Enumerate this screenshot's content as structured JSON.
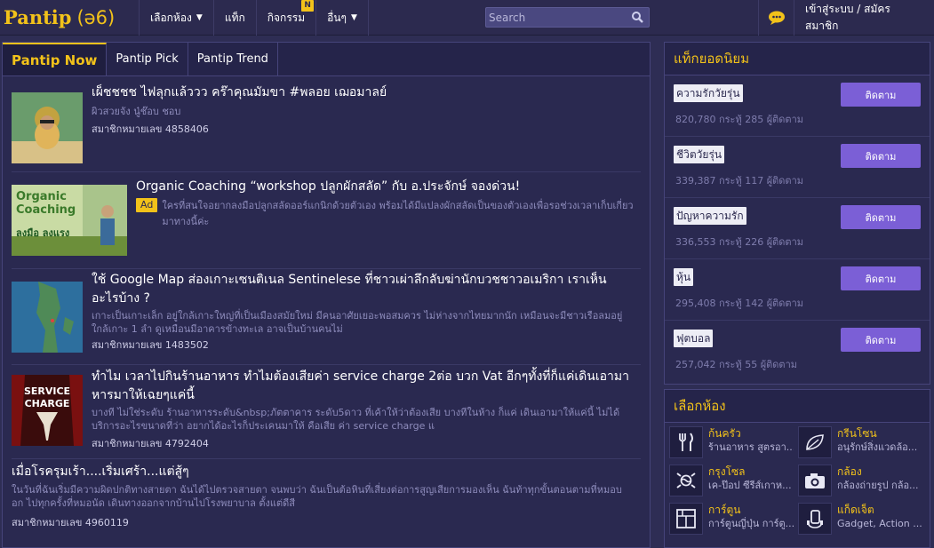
{
  "header": {
    "logo_text": "Pantip",
    "logo_thai": "(ə6)",
    "nav": [
      {
        "label": "เลือกห้อง",
        "has_caret": true
      },
      {
        "label": "แท็ก",
        "has_caret": false
      },
      {
        "label": "กิจกรรม",
        "has_caret": false,
        "badge": "N"
      },
      {
        "label": "อื่นๆ",
        "has_caret": true
      }
    ],
    "search_placeholder": "Search",
    "login_label": "เข้าสู่ระบบ / สมัครสมาชิก"
  },
  "tabs": [
    {
      "label": "Pantip Now",
      "active": true
    },
    {
      "label": "Pantip Pick",
      "active": false
    },
    {
      "label": "Pantip Trend",
      "active": false
    }
  ],
  "feed": [
    {
      "title": "เผ็ชชชช ไฟลุกแล้ววว คร๊าคุณมัมขา #พลอย เฌอมาลย์",
      "desc": "ผิวสวยจัง นู๋ช๊อบ ชอบ",
      "member": "สมาชิกหมายเลข 4858406"
    },
    {
      "title": "Organic Coaching “workshop ปลูกผักสลัด” กับ อ.ประจักษ์ จองด่วน!",
      "ad": "Ad",
      "desc": "ใครที่สนใจอยากลงมือปลูกสลัดออร์แกนิกด้วยตัวเอง พร้อมได้มีแปลงผักสลัดเป็นของตัวเองเพื่อรอช่วงเวลาเก็บเกี่ยวมาทางนี้ค่ะ",
      "thumb_text": [
        "Organic",
        "Coaching",
        "ลงมือ ลงแรง"
      ]
    },
    {
      "title": "ใช้ Google Map ส่องเกาะเซนติเนล Sentinelese ที่ชาวเผ่าลึกลับฆ่านักบวชชาวอเมริกา เราเห็นอะไรบ้าง ?",
      "desc": "เกาะเป็นเกาะเล็ก อยู่ใกล้เกาะใหญ่ที่เป็นเมืองสมัยใหม่ มีคนอาศัยเยอะพอสมควร ไม่ห่างจากไทยมากนัก เหมือนจะมีชาวเรือลมอยู่ใกล้เกาะ 1 ลำ ดูเหมือนมีอาคารข้างทะเล อาจเป็นบ้านคนไม่",
      "member": "สมาชิกหมายเลข 1483502"
    },
    {
      "title": "ทำไม เวลาไปกินร้านอาหาร ทำไมต้องเสียค่า service charge 2ต่อ บวก Vat อีกๆทั้งที่ก็แค่เดินเอามาหารมาให้เฉยๆแค่นี้",
      "desc": "บางที ไม่ใช่ระดับ ร้านอาหารระดับ&nbsp;ภัตตาคาร ระดับ5ดาว ที่เค้าให้ว่าต้องเสีย บางทีในห้าง ก็แค่ เดินเอามาให้แค่นี้ ไม่ได้บริการอะไรขนาดที่ว่า อยากได้อะไรก็ประเคนมาให้ คือเสีย ค่า service charge แ",
      "member": "สมาชิกหมายเลข 4792404",
      "thumb_text": [
        "SERVICE",
        "CHARGE"
      ]
    },
    {
      "title": "เมื่อโรครุมเร้า....เริ่มเศร้า...แต่สู้ๆ",
      "desc": "ในวันที่ฉันเริ่มมีความผิดปกติทางสายตา ฉันได้ไปตรวจสายตา จนพบว่า ฉันเป็นต้อหินที่เสี่ยงต่อการสูญเสียการมองเห็น ฉันท้าทุกขั้นตอนตามที่หมอบอก ไปทุกครั้งที่หมอนัด เดินทางออกจากบ้านไปโรงพยาบาล ตั้งแต่ดีสี",
      "member": "สมาชิกหมายเลข 4960119"
    }
  ],
  "popular_tags": {
    "title": "แท็กยอดนิยม",
    "follow_label": "ติดตาม",
    "items": [
      {
        "name": "ความรักวัยรุ่น",
        "stats": "820,780 กระทู้  285 ผู้ติดตาม"
      },
      {
        "name": "ชีวิตวัยรุ่น",
        "stats": "339,387 กระทู้  117 ผู้ติดตาม"
      },
      {
        "name": "ปัญหาความรัก",
        "stats": "336,553 กระทู้  226 ผู้ติดตาม"
      },
      {
        "name": "หุ้น",
        "stats": "295,408 กระทู้  142 ผู้ติดตาม"
      },
      {
        "name": "ฟุตบอล",
        "stats": "257,042 กระทู้  55 ผู้ติดตาม"
      }
    ]
  },
  "rooms": {
    "title": "เลือกห้อง",
    "items": [
      {
        "name": "ก้นครัว",
        "desc": "ร้านอาหาร สูตรอา...",
        "icon": "fork-knife-icon"
      },
      {
        "name": "กรีนโซน",
        "desc": "อนุรักษ์สิ่งแวดล้อ...",
        "icon": "leaf-icon"
      },
      {
        "name": "กรุงโซล",
        "desc": "เค-ป๊อป ซีรีส์เกาห...",
        "icon": "korea-flag-icon"
      },
      {
        "name": "กล้อง",
        "desc": "กล้องถ่ายรูป กล้อ...",
        "icon": "camera-icon"
      },
      {
        "name": "การ์ตูน",
        "desc": "การ์ตูนญี่ปุ่น การ์ตู...",
        "icon": "comic-icon"
      },
      {
        "name": "แก็ดเจ็ต",
        "desc": "Gadget, Action ...",
        "icon": "gadget-icon"
      }
    ]
  }
}
